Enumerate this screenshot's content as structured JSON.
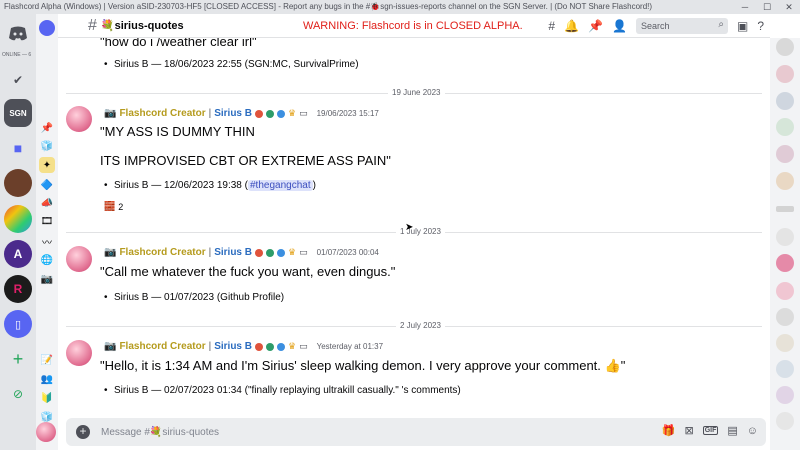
{
  "window": {
    "title": "Flashcord Alpha (Windows) | Version aSID-230703-HF5 [CLOSED ACCESS] - Report any bugs in the #🐞sgn-issues-reports channel on the SGN Server. | (Do NOT Share Flashcord!)",
    "minimize": "─",
    "maximize": "☐",
    "close": "✕"
  },
  "servers": {
    "online_label": "ONLINE — 6",
    "sgn_label": "SGN",
    "add_icon": "+",
    "explore_icon": "compass-icon"
  },
  "header": {
    "hash": "#",
    "channel_name": "💐sirius-quotes",
    "warning": "WARNING: Flashcord is in CLOSED ALPHA.",
    "search_placeholder": "Search",
    "icons": [
      "threads-icon",
      "bell-icon",
      "pin-icon",
      "members-icon",
      "inbox-icon",
      "help-icon"
    ]
  },
  "messages": [
    {
      "type": "continuation",
      "quote": "\"how do i /weather clear irl\"",
      "attribution": "Sirius B — 18/06/2023 22:55 (SGN:MC, SurvivalPrime)"
    },
    {
      "date_divider": "19 June 2023",
      "role": "Flashcord Creator",
      "separator": "|",
      "username": "Sirius B",
      "timestamp": "19/06/2023 15:17",
      "quote_lines": [
        "\"MY ASS IS DUMMY THIN",
        "ITS IMPROVISED CBT OR EXTREME ASS PAIN\""
      ],
      "attribution_prefix": "Sirius B — 12/06/2023 19:38 (",
      "attribution_mention": "#thegangchat",
      "attribution_suffix": ")",
      "reaction_emoji": "🧱",
      "reaction_count": "2"
    },
    {
      "date_divider": "1 July 2023",
      "role": "Flashcord Creator",
      "separator": "|",
      "username": "Sirius B",
      "timestamp": "01/07/2023 00:04",
      "quote": "\"Call me whatever the fuck you want, even dingus.\"",
      "attribution": "Sirius B — 01/07/2023 (Github Profile)"
    },
    {
      "date_divider": "2 July 2023",
      "role": "Flashcord Creator",
      "separator": "|",
      "username": "Sirius B",
      "timestamp": "Yesterday at 01:37",
      "quote": "\"Hello, it is 1:34 AM and I'm Sirius' sleep walking demon. I very approve your comment. 👍\"",
      "attribution": "Sirius B — 02/07/2023 01:34 (\"finally replaying ultrakill casually.\" 's comments)"
    }
  ],
  "composer": {
    "placeholder": "Message #💐sirius-quotes",
    "plus": "+",
    "gif_label": "GIF"
  },
  "colors": {
    "role": "#b59b1e",
    "username": "#2b6cbf",
    "warning": "#e0201a"
  }
}
